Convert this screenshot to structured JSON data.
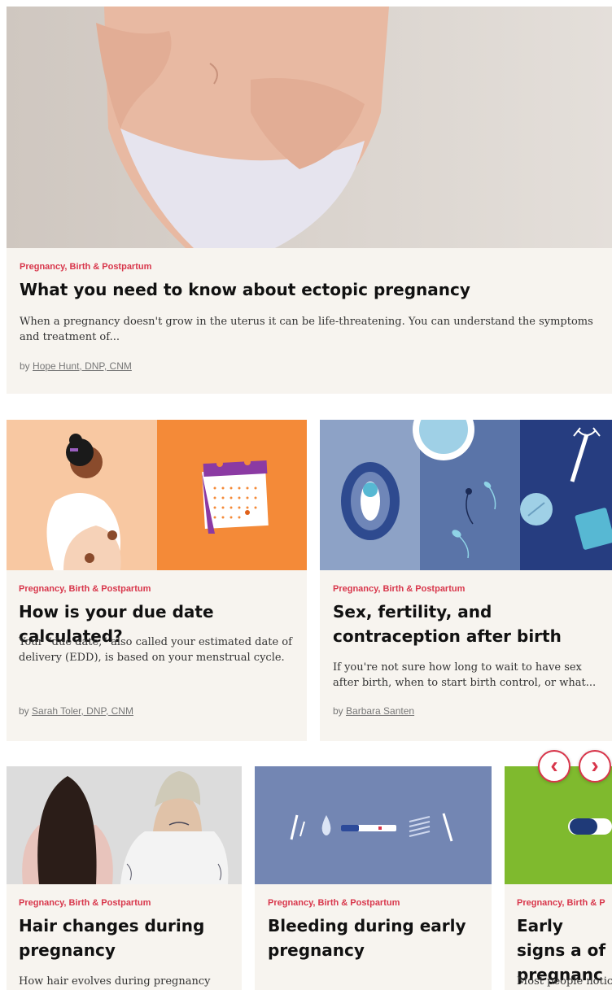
{
  "featured": {
    "category": "Pregnancy, Birth & Postpartum",
    "title": "What you need to know about ectopic pregnancy",
    "description": "When a pregnancy doesn't grow in the uterus it can be life-threatening. You can understand the symptoms and treatment of...",
    "by": "by",
    "author": "Hope Hunt, DNP, CNM"
  },
  "row2": [
    {
      "category": "Pregnancy, Birth & Postpartum",
      "title": "How is your due date calculated?",
      "description": "Your “due date,” also called your estimated date of delivery (EDD), is based on your menstrual cycle.",
      "by": "by",
      "author": "Sarah Toler, DNP, CNM"
    },
    {
      "category": "Pregnancy, Birth & Postpartum",
      "title": "Sex, fertility, and contraception after birth",
      "description": "If you're not sure how long to wait to have sex after birth, when to start birth control, or what...",
      "by": "by",
      "author": "Barbara Santen"
    }
  ],
  "carousel": {
    "prev_icon": "chevron-left-icon",
    "next_icon": "chevron-right-icon",
    "prev_glyph": "‹",
    "next_glyph": "›",
    "items": [
      {
        "category": "Pregnancy, Birth & Postpartum",
        "title": "Hair changes during pregnancy",
        "description": "How hair evolves during pregnancy"
      },
      {
        "category": "Pregnancy, Birth & Postpartum",
        "title": "Bleeding during early pregnancy",
        "description": ""
      },
      {
        "category": "Pregnancy, Birth & P",
        "title": "Early signs a of pregnanc",
        "description": "Most people notic"
      }
    ]
  },
  "colors": {
    "accent": "#d8364b",
    "card_bg": "#f7f4ef"
  }
}
